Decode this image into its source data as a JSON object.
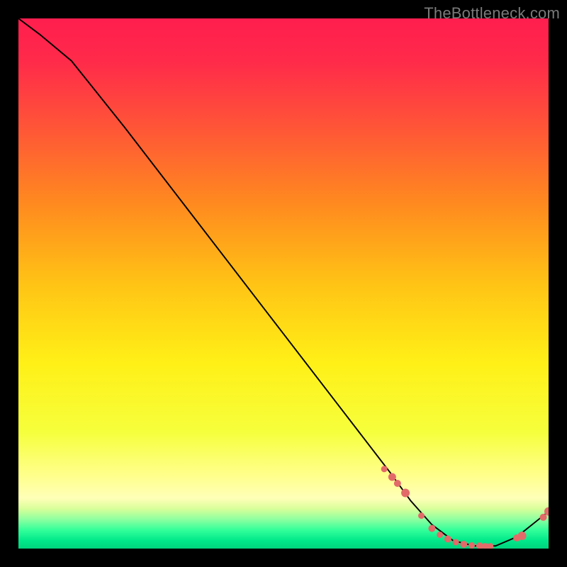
{
  "watermark": "TheBottleneck.com",
  "chart_data": {
    "type": "line",
    "title": "",
    "xlabel": "",
    "ylabel": "",
    "xlim": [
      0,
      100
    ],
    "ylim": [
      0,
      100
    ],
    "grid": false,
    "series": [
      {
        "name": "curve",
        "x": [
          0,
          4,
          10,
          20,
          30,
          40,
          50,
          60,
          70,
          74,
          78,
          82,
          86,
          90,
          94,
          100
        ],
        "values": [
          100,
          97,
          92,
          79.5,
          66.5,
          53.5,
          40.5,
          27.5,
          14.5,
          9,
          4.5,
          1.5,
          0.5,
          0.5,
          2.2,
          7
        ]
      }
    ],
    "markers": {
      "name": "dots",
      "color": "#e26b69",
      "x": [
        69,
        70.5,
        71.5,
        73,
        76,
        78,
        79.5,
        81,
        82.5,
        84,
        85.5,
        87,
        88,
        89,
        94,
        95,
        99,
        100
      ],
      "values": [
        15,
        13.5,
        12.3,
        10.5,
        6.2,
        3.8,
        2.6,
        1.8,
        1.2,
        0.8,
        0.6,
        0.5,
        0.45,
        0.45,
        2.0,
        2.4,
        5.9,
        7.0
      ],
      "radius": [
        4.5,
        5.5,
        5,
        6,
        4.5,
        5,
        4.5,
        5,
        4.5,
        5,
        4.5,
        5,
        4.5,
        4.5,
        5,
        6,
        5,
        6
      ]
    },
    "gradient_stops": [
      {
        "offset": 0.0,
        "color": "#ff1e4e"
      },
      {
        "offset": 0.08,
        "color": "#ff2a4a"
      },
      {
        "offset": 0.2,
        "color": "#ff5338"
      },
      {
        "offset": 0.35,
        "color": "#ff8a1f"
      },
      {
        "offset": 0.5,
        "color": "#ffc315"
      },
      {
        "offset": 0.65,
        "color": "#fff017"
      },
      {
        "offset": 0.78,
        "color": "#f6ff3c"
      },
      {
        "offset": 0.86,
        "color": "#ffff8a"
      },
      {
        "offset": 0.905,
        "color": "#ffffb8"
      },
      {
        "offset": 0.925,
        "color": "#d8ff9a"
      },
      {
        "offset": 0.945,
        "color": "#8dffa0"
      },
      {
        "offset": 0.965,
        "color": "#33ff9a"
      },
      {
        "offset": 0.985,
        "color": "#00e88a"
      },
      {
        "offset": 1.0,
        "color": "#00d37d"
      }
    ]
  }
}
